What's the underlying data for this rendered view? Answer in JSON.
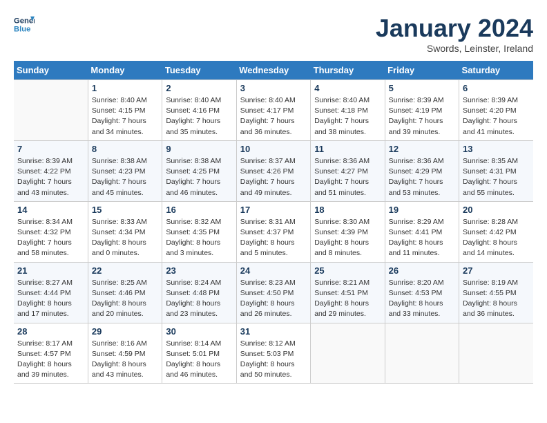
{
  "header": {
    "logo_line1": "General",
    "logo_line2": "Blue",
    "month": "January 2024",
    "location": "Swords, Leinster, Ireland"
  },
  "weekdays": [
    "Sunday",
    "Monday",
    "Tuesday",
    "Wednesday",
    "Thursday",
    "Friday",
    "Saturday"
  ],
  "weeks": [
    [
      {
        "day": "",
        "sunrise": "",
        "sunset": "",
        "daylight": ""
      },
      {
        "day": "1",
        "sunrise": "Sunrise: 8:40 AM",
        "sunset": "Sunset: 4:15 PM",
        "daylight": "Daylight: 7 hours and 34 minutes."
      },
      {
        "day": "2",
        "sunrise": "Sunrise: 8:40 AM",
        "sunset": "Sunset: 4:16 PM",
        "daylight": "Daylight: 7 hours and 35 minutes."
      },
      {
        "day": "3",
        "sunrise": "Sunrise: 8:40 AM",
        "sunset": "Sunset: 4:17 PM",
        "daylight": "Daylight: 7 hours and 36 minutes."
      },
      {
        "day": "4",
        "sunrise": "Sunrise: 8:40 AM",
        "sunset": "Sunset: 4:18 PM",
        "daylight": "Daylight: 7 hours and 38 minutes."
      },
      {
        "day": "5",
        "sunrise": "Sunrise: 8:39 AM",
        "sunset": "Sunset: 4:19 PM",
        "daylight": "Daylight: 7 hours and 39 minutes."
      },
      {
        "day": "6",
        "sunrise": "Sunrise: 8:39 AM",
        "sunset": "Sunset: 4:20 PM",
        "daylight": "Daylight: 7 hours and 41 minutes."
      }
    ],
    [
      {
        "day": "7",
        "sunrise": "Sunrise: 8:39 AM",
        "sunset": "Sunset: 4:22 PM",
        "daylight": "Daylight: 7 hours and 43 minutes."
      },
      {
        "day": "8",
        "sunrise": "Sunrise: 8:38 AM",
        "sunset": "Sunset: 4:23 PM",
        "daylight": "Daylight: 7 hours and 45 minutes."
      },
      {
        "day": "9",
        "sunrise": "Sunrise: 8:38 AM",
        "sunset": "Sunset: 4:25 PM",
        "daylight": "Daylight: 7 hours and 46 minutes."
      },
      {
        "day": "10",
        "sunrise": "Sunrise: 8:37 AM",
        "sunset": "Sunset: 4:26 PM",
        "daylight": "Daylight: 7 hours and 49 minutes."
      },
      {
        "day": "11",
        "sunrise": "Sunrise: 8:36 AM",
        "sunset": "Sunset: 4:27 PM",
        "daylight": "Daylight: 7 hours and 51 minutes."
      },
      {
        "day": "12",
        "sunrise": "Sunrise: 8:36 AM",
        "sunset": "Sunset: 4:29 PM",
        "daylight": "Daylight: 7 hours and 53 minutes."
      },
      {
        "day": "13",
        "sunrise": "Sunrise: 8:35 AM",
        "sunset": "Sunset: 4:31 PM",
        "daylight": "Daylight: 7 hours and 55 minutes."
      }
    ],
    [
      {
        "day": "14",
        "sunrise": "Sunrise: 8:34 AM",
        "sunset": "Sunset: 4:32 PM",
        "daylight": "Daylight: 7 hours and 58 minutes."
      },
      {
        "day": "15",
        "sunrise": "Sunrise: 8:33 AM",
        "sunset": "Sunset: 4:34 PM",
        "daylight": "Daylight: 8 hours and 0 minutes."
      },
      {
        "day": "16",
        "sunrise": "Sunrise: 8:32 AM",
        "sunset": "Sunset: 4:35 PM",
        "daylight": "Daylight: 8 hours and 3 minutes."
      },
      {
        "day": "17",
        "sunrise": "Sunrise: 8:31 AM",
        "sunset": "Sunset: 4:37 PM",
        "daylight": "Daylight: 8 hours and 5 minutes."
      },
      {
        "day": "18",
        "sunrise": "Sunrise: 8:30 AM",
        "sunset": "Sunset: 4:39 PM",
        "daylight": "Daylight: 8 hours and 8 minutes."
      },
      {
        "day": "19",
        "sunrise": "Sunrise: 8:29 AM",
        "sunset": "Sunset: 4:41 PM",
        "daylight": "Daylight: 8 hours and 11 minutes."
      },
      {
        "day": "20",
        "sunrise": "Sunrise: 8:28 AM",
        "sunset": "Sunset: 4:42 PM",
        "daylight": "Daylight: 8 hours and 14 minutes."
      }
    ],
    [
      {
        "day": "21",
        "sunrise": "Sunrise: 8:27 AM",
        "sunset": "Sunset: 4:44 PM",
        "daylight": "Daylight: 8 hours and 17 minutes."
      },
      {
        "day": "22",
        "sunrise": "Sunrise: 8:25 AM",
        "sunset": "Sunset: 4:46 PM",
        "daylight": "Daylight: 8 hours and 20 minutes."
      },
      {
        "day": "23",
        "sunrise": "Sunrise: 8:24 AM",
        "sunset": "Sunset: 4:48 PM",
        "daylight": "Daylight: 8 hours and 23 minutes."
      },
      {
        "day": "24",
        "sunrise": "Sunrise: 8:23 AM",
        "sunset": "Sunset: 4:50 PM",
        "daylight": "Daylight: 8 hours and 26 minutes."
      },
      {
        "day": "25",
        "sunrise": "Sunrise: 8:21 AM",
        "sunset": "Sunset: 4:51 PM",
        "daylight": "Daylight: 8 hours and 29 minutes."
      },
      {
        "day": "26",
        "sunrise": "Sunrise: 8:20 AM",
        "sunset": "Sunset: 4:53 PM",
        "daylight": "Daylight: 8 hours and 33 minutes."
      },
      {
        "day": "27",
        "sunrise": "Sunrise: 8:19 AM",
        "sunset": "Sunset: 4:55 PM",
        "daylight": "Daylight: 8 hours and 36 minutes."
      }
    ],
    [
      {
        "day": "28",
        "sunrise": "Sunrise: 8:17 AM",
        "sunset": "Sunset: 4:57 PM",
        "daylight": "Daylight: 8 hours and 39 minutes."
      },
      {
        "day": "29",
        "sunrise": "Sunrise: 8:16 AM",
        "sunset": "Sunset: 4:59 PM",
        "daylight": "Daylight: 8 hours and 43 minutes."
      },
      {
        "day": "30",
        "sunrise": "Sunrise: 8:14 AM",
        "sunset": "Sunset: 5:01 PM",
        "daylight": "Daylight: 8 hours and 46 minutes."
      },
      {
        "day": "31",
        "sunrise": "Sunrise: 8:12 AM",
        "sunset": "Sunset: 5:03 PM",
        "daylight": "Daylight: 8 hours and 50 minutes."
      },
      {
        "day": "",
        "sunrise": "",
        "sunset": "",
        "daylight": ""
      },
      {
        "day": "",
        "sunrise": "",
        "sunset": "",
        "daylight": ""
      },
      {
        "day": "",
        "sunrise": "",
        "sunset": "",
        "daylight": ""
      }
    ]
  ]
}
